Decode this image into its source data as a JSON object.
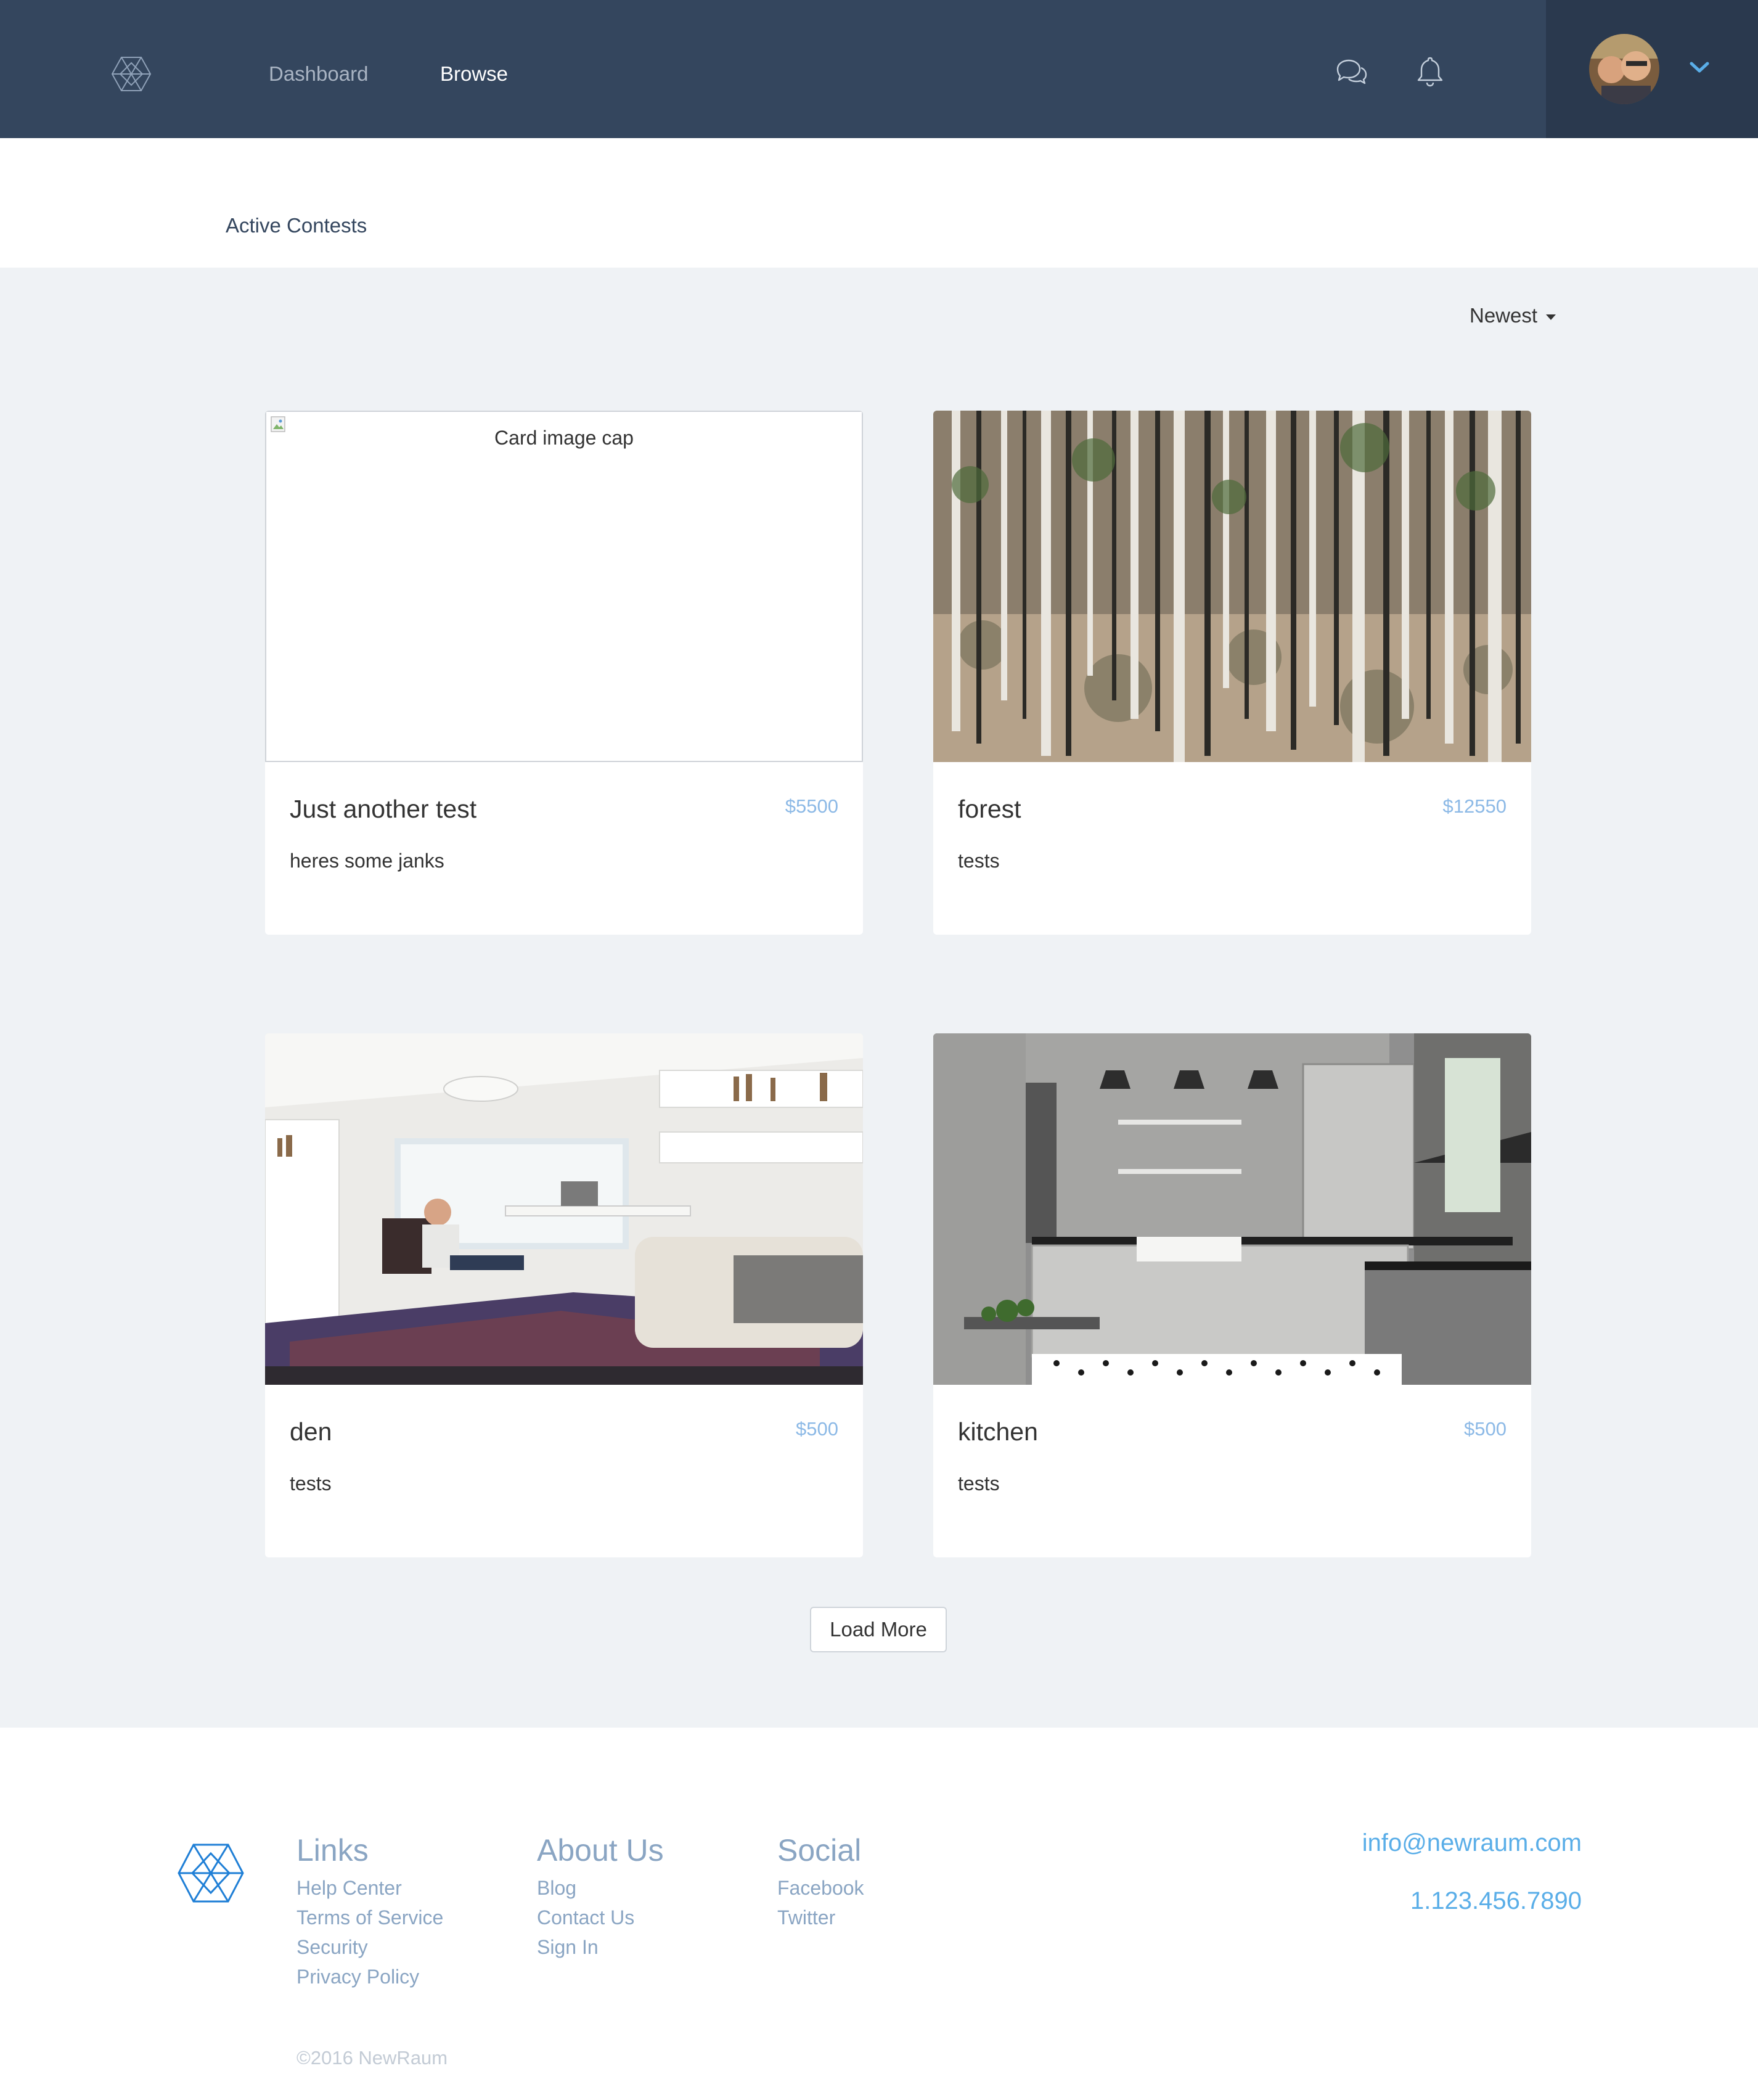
{
  "nav": {
    "dashboard_label": "Dashboard",
    "browse_label": "Browse",
    "icons": [
      "hexagon-logo-icon",
      "chat-bubbles-icon",
      "bell-icon",
      "chevron-down-icon"
    ],
    "accent_color": "#34465e"
  },
  "tabs": {
    "active_label": "Active Contests"
  },
  "sort": {
    "selected": "Newest"
  },
  "cards": [
    {
      "title": "Just another test",
      "price": "$5500",
      "description": "heres some janks",
      "image_alt": "Card image cap"
    },
    {
      "title": "forest",
      "price": "$12550",
      "description": "tests"
    },
    {
      "title": "den",
      "price": "$500",
      "description": "tests"
    },
    {
      "title": "kitchen",
      "price": "$500",
      "description": "tests"
    }
  ],
  "load_more_label": "Load More",
  "footer": {
    "links": {
      "heading": "Links",
      "items": [
        "Help Center",
        "Terms of Service",
        "Security",
        "Privacy Policy"
      ]
    },
    "about": {
      "heading": "About Us",
      "items": [
        "Blog",
        "Contact Us",
        "Sign In"
      ]
    },
    "social": {
      "heading": "Social",
      "items": [
        "Facebook",
        "Twitter"
      ]
    },
    "email": "info@newraum.com",
    "phone": "1.123.456.7890",
    "copyright": "©2016 NewRaum"
  }
}
